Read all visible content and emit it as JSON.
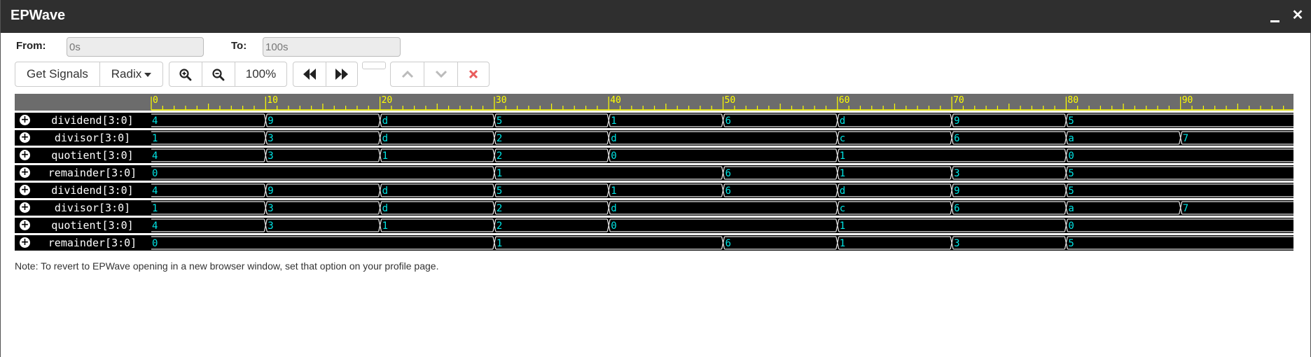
{
  "window": {
    "title": "EPWave",
    "minimize_label": "_",
    "close_label": "✕"
  },
  "range": {
    "from_label": "From:",
    "from_value": "0s",
    "to_label": "To:",
    "to_value": "100s"
  },
  "toolbar": {
    "get_signals": "Get Signals",
    "radix": "Radix",
    "zoom_in_icon": "magnifier-plus-icon",
    "zoom_out_icon": "magnifier-minus-icon",
    "zoom": "100%",
    "rewind_icon": "double-chevron-left-icon",
    "forward_icon": "double-chevron-right-icon",
    "up_icon": "chevron-up-icon",
    "down_icon": "chevron-down-icon",
    "remove_icon": "close-x-icon"
  },
  "colors": {
    "ruler_text": "#ffff00",
    "wave_value": "#00e5e5",
    "wave_line": "#e8e8e8",
    "remove": "#e95b5b"
  },
  "timeline": {
    "start": 0,
    "end": 100,
    "labels": [
      "0",
      "10",
      "20",
      "30",
      "40",
      "50",
      "60",
      "70",
      "80",
      "90"
    ]
  },
  "signals": [
    {
      "name": "dividend[3:0]",
      "segments": [
        [
          0,
          "4"
        ],
        [
          10,
          "9"
        ],
        [
          20,
          "d"
        ],
        [
          30,
          "5"
        ],
        [
          40,
          "1"
        ],
        [
          50,
          "6"
        ],
        [
          60,
          "d"
        ],
        [
          70,
          "9"
        ],
        [
          80,
          "5"
        ]
      ]
    },
    {
      "name": "divisor[3:0]",
      "segments": [
        [
          0,
          "1"
        ],
        [
          10,
          "3"
        ],
        [
          20,
          "d"
        ],
        [
          30,
          "2"
        ],
        [
          40,
          "d"
        ],
        [
          60,
          "c"
        ],
        [
          70,
          "6"
        ],
        [
          80,
          "a"
        ],
        [
          90,
          "7"
        ]
      ]
    },
    {
      "name": "quotient[3:0]",
      "segments": [
        [
          0,
          "4"
        ],
        [
          10,
          "3"
        ],
        [
          20,
          "1"
        ],
        [
          30,
          "2"
        ],
        [
          40,
          "0"
        ],
        [
          60,
          "1"
        ],
        [
          80,
          "0"
        ]
      ]
    },
    {
      "name": "remainder[3:0]",
      "segments": [
        [
          0,
          "0"
        ],
        [
          30,
          "1"
        ],
        [
          50,
          "6"
        ],
        [
          60,
          "1"
        ],
        [
          70,
          "3"
        ],
        [
          80,
          "5"
        ]
      ]
    },
    {
      "name": "dividend[3:0]",
      "segments": [
        [
          0,
          "4"
        ],
        [
          10,
          "9"
        ],
        [
          20,
          "d"
        ],
        [
          30,
          "5"
        ],
        [
          40,
          "1"
        ],
        [
          50,
          "6"
        ],
        [
          60,
          "d"
        ],
        [
          70,
          "9"
        ],
        [
          80,
          "5"
        ]
      ]
    },
    {
      "name": "divisor[3:0]",
      "segments": [
        [
          0,
          "1"
        ],
        [
          10,
          "3"
        ],
        [
          20,
          "d"
        ],
        [
          30,
          "2"
        ],
        [
          40,
          "d"
        ],
        [
          60,
          "c"
        ],
        [
          70,
          "6"
        ],
        [
          80,
          "a"
        ],
        [
          90,
          "7"
        ]
      ]
    },
    {
      "name": "quotient[3:0]",
      "segments": [
        [
          0,
          "4"
        ],
        [
          10,
          "3"
        ],
        [
          20,
          "1"
        ],
        [
          30,
          "2"
        ],
        [
          40,
          "0"
        ],
        [
          60,
          "1"
        ],
        [
          80,
          "0"
        ]
      ]
    },
    {
      "name": "remainder[3:0]",
      "segments": [
        [
          0,
          "0"
        ],
        [
          30,
          "1"
        ],
        [
          50,
          "6"
        ],
        [
          60,
          "1"
        ],
        [
          70,
          "3"
        ],
        [
          80,
          "5"
        ]
      ]
    }
  ],
  "note": "Note: To revert to EPWave opening in a new browser window, set that option on your profile page."
}
